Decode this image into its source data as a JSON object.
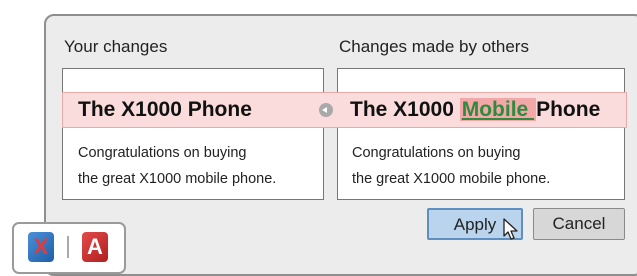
{
  "dialog": {
    "your_changes_label": "Your changes",
    "others_changes_label": "Changes made by others",
    "left": {
      "title": "The X1000 Phone",
      "line1": "Congratulations on buying",
      "line2": "the great X1000 mobile phone."
    },
    "right": {
      "title_before": "The X1000 ",
      "title_highlight": "Mobile ",
      "title_after": "Phone",
      "line1": "Congratulations on buying",
      "line2": "the great X1000 mobile phone."
    },
    "apply_label": "Apply",
    "cancel_label": "Cancel"
  },
  "colors": {
    "conflict_band": "#fbdcdc",
    "highlight_bg": "#f2a8a8",
    "highlight_text": "#2e8b3e",
    "apply_button": "#b9d4ec"
  },
  "icons": {
    "merge_arrow": "arrow-left-circle-icon",
    "app1": "app-x-icon",
    "app2": "app-a-icon",
    "cursor": "mouse-pointer-icon"
  },
  "app_icons": {
    "x_glyph": "X",
    "a_glyph": "A"
  }
}
